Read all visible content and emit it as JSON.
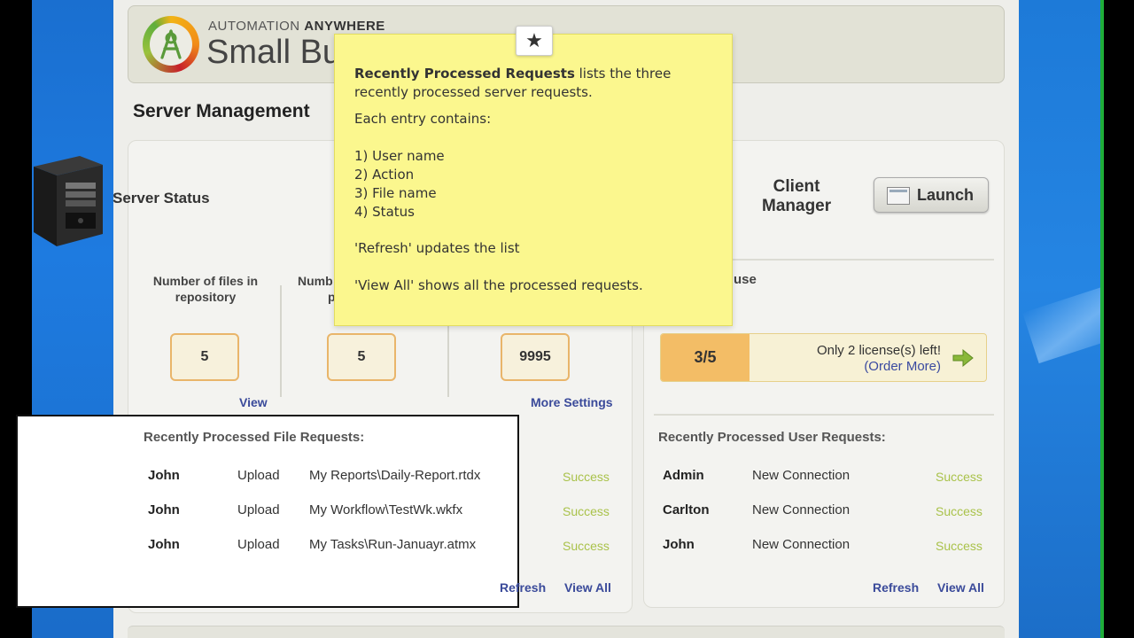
{
  "brand": {
    "top_light": "AUTOMATION ",
    "top_bold": "ANYWHERE",
    "main": "Small Bu"
  },
  "page": {
    "title": "Server Management"
  },
  "server": {
    "status_label": "Server Status",
    "stats": [
      {
        "label_line1": "Number of files in",
        "label_line2": "repository",
        "value": "5"
      },
      {
        "label_line1": "Numb",
        "label_line2": "p",
        "value": "5"
      },
      {
        "value": "9995"
      }
    ],
    "view_link": "View",
    "more_settings_link": "More Settings"
  },
  "file_requests": {
    "title": "Recently Processed File Requests:",
    "rows": [
      {
        "user": "John",
        "action": "Upload",
        "file": "My Reports\\Daily-Report.rtdx",
        "status": "Success"
      },
      {
        "user": "John",
        "action": "Upload",
        "file": "My Workflow\\TestWk.wkfx",
        "status": "Success"
      },
      {
        "user": "John",
        "action": "Upload",
        "file": "My Tasks\\Run-Januayr.atmx",
        "status": "Success"
      }
    ],
    "refresh_link": "Refresh",
    "view_all_link": "View All"
  },
  "client": {
    "label_line1": "Client",
    "label_line2": "Manager",
    "launch_button": "Launch",
    "license_use_label": "use",
    "license_count": "3/5",
    "license_message": "Only 2 license(s) left!",
    "order_more_link": "(Order More)"
  },
  "user_requests": {
    "title": "Recently Processed User Requests:",
    "rows": [
      {
        "user": "Admin",
        "action": "New Connection",
        "status": "Success"
      },
      {
        "user": "Carlton",
        "action": "New Connection",
        "status": "Success"
      },
      {
        "user": "John",
        "action": "New Connection",
        "status": "Success"
      }
    ],
    "refresh_link": "Refresh",
    "view_all_link": "View All"
  },
  "tooltip": {
    "star": "★",
    "heading_bold": "Recently Processed Requests",
    "heading_rest": " lists the three",
    "heading_line2": "recently processed server requests.",
    "entry_intro": "Each entry contains:",
    "items": [
      "1) User name",
      "2) Action",
      "3) File name",
      "4) Status"
    ],
    "refresh_note": "'Refresh' updates the list",
    "view_all_note": "'View All' shows all the processed requests."
  },
  "colors": {
    "success": "#a9c24a",
    "link": "#3a4a9a",
    "stat_border": "#e9b56a",
    "license_fill": "#f3bd66",
    "tooltip_bg": "#fbf78e",
    "desktop_blue": "#1e7be0"
  },
  "license_usage": {
    "used": 3,
    "total": 5
  }
}
